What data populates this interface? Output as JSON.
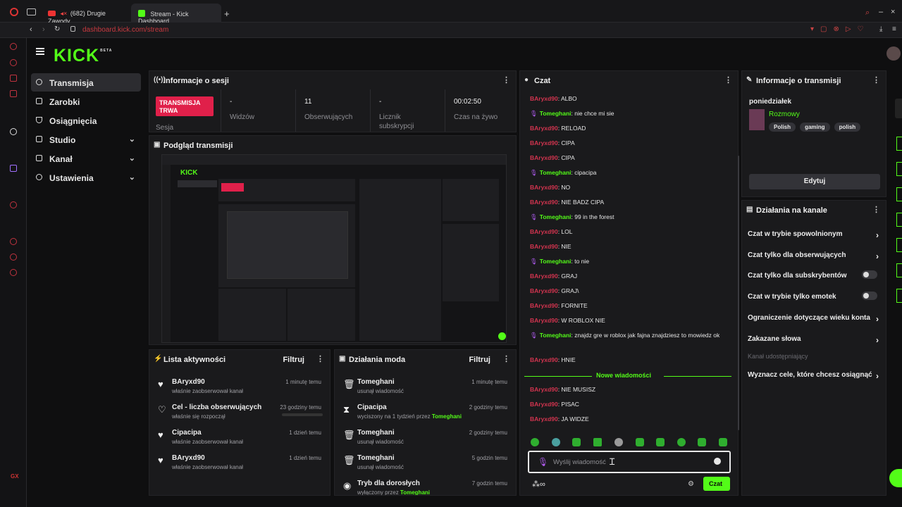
{
  "browser": {
    "tabs": [
      {
        "title": "(682) Drugie Zawody"
      },
      {
        "title": "Stream - Kick Dashboard"
      }
    ],
    "new_tab_symbol": "+",
    "url": "dashboard.kick.com/stream"
  },
  "app": {
    "logo": "KICK",
    "logo_sup": "BETA"
  },
  "nav": [
    {
      "label": "Transmisja",
      "icon": "broadcast-icon",
      "active": true
    },
    {
      "label": "Zarobki",
      "icon": "wallet-icon"
    },
    {
      "label": "Osiągnięcia",
      "icon": "trophy-icon"
    },
    {
      "label": "Studio",
      "icon": "studio-icon",
      "expandable": true
    },
    {
      "label": "Kanał",
      "icon": "channel-icon",
      "expandable": true
    },
    {
      "label": "Ustawienia",
      "icon": "gear-icon",
      "expandable": true
    }
  ],
  "session": {
    "title": "Informacje o sesji",
    "live_badge": "TRANSMISJA TRWA",
    "session_label": "Sesja",
    "viewers_value": "-",
    "viewers_label": "Widzów",
    "followers_value": "11",
    "followers_label": "Obserwujących",
    "subs_value": "-",
    "subs_label": "Licznik subskrypcji",
    "time_value": "00:02:50",
    "time_label": "Czas na żywo"
  },
  "preview": {
    "title": "Podgląd transmisji"
  },
  "activity": {
    "title": "Lista aktywności",
    "filter": "Filtruj",
    "items": [
      {
        "name": "BAryxd90",
        "desc": "właśnie zaobserwował kanał",
        "time": "1 minutę temu",
        "icon": "heart-icon"
      },
      {
        "name": "Cel - liczba obserwujących",
        "desc": "właśnie się rozpoczął",
        "time": "23 godziny temu",
        "icon": "heart-outline-icon"
      },
      {
        "name": "Cipacipa",
        "desc": "właśnie zaobserwował kanał",
        "time": "1 dzień temu",
        "icon": "heart-icon"
      },
      {
        "name": "BAryxd90",
        "desc": "właśnie zaobserwował kanał",
        "time": "1 dzień temu",
        "icon": "heart-icon"
      }
    ]
  },
  "mod": {
    "title": "Działania moda",
    "filter": "Filtruj",
    "items": [
      {
        "name": "Tomeghani",
        "desc": "usunął wiadomość",
        "highlight": "",
        "time": "1 minutę temu",
        "icon": "trash-icon"
      },
      {
        "name": "Cipacipa",
        "desc": "wyciszony na 1 tydzień przez",
        "highlight": "Tomeghani",
        "time": "2 godziny temu",
        "icon": "hourglass-icon"
      },
      {
        "name": "Tomeghani",
        "desc": "usunął wiadomość",
        "highlight": "",
        "time": "2 godziny temu",
        "icon": "trash-icon"
      },
      {
        "name": "Tomeghani",
        "desc": "usunął wiadomość",
        "highlight": "",
        "time": "5 godzin temu",
        "icon": "trash-icon"
      },
      {
        "name": "Tryb dla dorosłych",
        "desc": "wyłączony przez",
        "highlight": "Tomeghani",
        "time": "7 godzin temu",
        "icon": "eye-icon"
      }
    ]
  },
  "chat": {
    "title": "Czat",
    "messages": [
      {
        "user": "BAryxd90",
        "text": "ALBO",
        "mod": false
      },
      {
        "user": "Tomeghani",
        "text": "nie chce mi sie",
        "mod": true
      },
      {
        "user": "BAryxd90",
        "text": "RELOAD",
        "mod": false
      },
      {
        "user": "BAryxd90",
        "text": "CIPA",
        "mod": false
      },
      {
        "user": "BAryxd90",
        "text": "CIPA",
        "mod": false
      },
      {
        "user": "Tomeghani",
        "text": "cipacipa",
        "mod": true
      },
      {
        "user": "BAryxd90",
        "text": "NO",
        "mod": false
      },
      {
        "user": "BAryxd90",
        "text": "NIE BADZ CIPA",
        "mod": false
      },
      {
        "user": "Tomeghani",
        "text": "99 in the forest",
        "mod": true
      },
      {
        "user": "BAryxd90",
        "text": "LOL",
        "mod": false
      },
      {
        "user": "BAryxd90",
        "text": "NIE",
        "mod": false
      },
      {
        "user": "Tomeghani",
        "text": "to nie",
        "mod": true
      },
      {
        "user": "BAryxd90",
        "text": "GRAJ",
        "mod": false
      },
      {
        "user": "BAryxd90",
        "text": "GRAJ\\",
        "mod": false
      },
      {
        "user": "BAryxd90",
        "text": "FORNITE",
        "mod": false
      },
      {
        "user": "BAryxd90",
        "text": "W ROBLOX NIE",
        "mod": false
      },
      {
        "user": "Tomeghani",
        "text": "znajdz gre w roblox jak fajna znajdziesz to mowiedz ok",
        "mod": true
      },
      {
        "user": "BAryxd90",
        "text": "HNIE",
        "mod": false
      }
    ],
    "new_messages_label": "Nowe wiadomości",
    "new_messages": [
      {
        "user": "BAryxd90",
        "text": "NIE MUSISZ",
        "mod": false
      },
      {
        "user": "BAryxd90",
        "text": "PISAC",
        "mod": false
      },
      {
        "user": "BAryxd90",
        "text": "JA WIDZE",
        "mod": false
      }
    ],
    "input_placeholder": "Wyślij wiadomość",
    "send_label": "Czat"
  },
  "stream_info": {
    "title": "Informacje o transmisji",
    "day": "poniedziałek",
    "category": "Rozmowy",
    "tags": [
      "Polish",
      "gaming",
      "polish"
    ],
    "edit_label": "Edytuj"
  },
  "channel_actions": {
    "title": "Działania na kanale",
    "items": [
      {
        "label": "Czat w trybie spowolnionym",
        "control": "arrow"
      },
      {
        "label": "Czat tylko dla obserwujących",
        "control": "arrow"
      },
      {
        "label": "Czat tylko dla subskrybentów",
        "control": "toggle"
      },
      {
        "label": "Czat w trybie tylko emotek",
        "control": "toggle"
      },
      {
        "label": "Ograniczenie dotyczące wieku konta",
        "control": "arrow"
      },
      {
        "label": "Zakazane słowa",
        "control": "arrow"
      }
    ],
    "shared_label": "Kanał udostępniający",
    "goals_label": "Wyznacz cele, które chcesz osiągnąć"
  },
  "colors": {
    "accent": "#53fc18",
    "live": "#e0204a",
    "username_red": "#d3344f",
    "mod_purple": "#b05cf0"
  }
}
